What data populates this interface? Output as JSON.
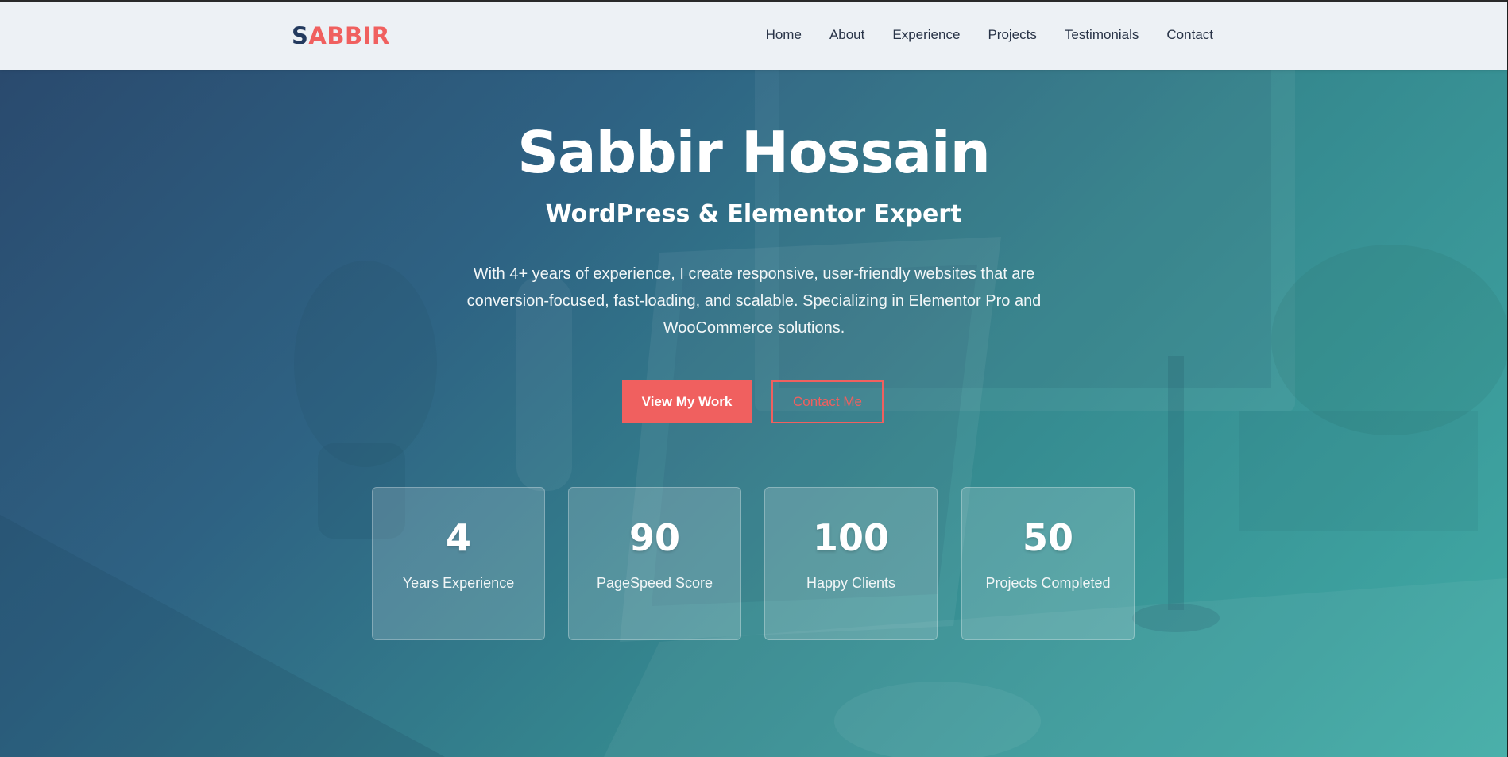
{
  "header": {
    "logo_first": "S",
    "logo_rest": "ABBIR",
    "nav": [
      "Home",
      "About",
      "Experience",
      "Projects",
      "Testimonials",
      "Contact"
    ]
  },
  "hero": {
    "title": "Sabbir Hossain",
    "subtitle": "WordPress & Elementor Expert",
    "description": "With 4+ years of experience, I create responsive, user-friendly websites that are conversion-focused, fast-loading, and scalable. Specializing in Elementor Pro and WooCommerce solutions.",
    "primary_button": "View My Work",
    "secondary_button": "Contact Me"
  },
  "stats": [
    {
      "value": "4",
      "label": "Years Experience"
    },
    {
      "value": "90",
      "label": "PageSpeed Score"
    },
    {
      "value": "100",
      "label": "Happy Clients"
    },
    {
      "value": "50",
      "label": "Projects Completed"
    }
  ],
  "colors": {
    "accent": "#f0605f",
    "brand_dark": "#233a5e",
    "hero_gradient_start": "#2a4a6e",
    "hero_gradient_end": "#41aca6",
    "header_bg": "#edf1f5"
  }
}
